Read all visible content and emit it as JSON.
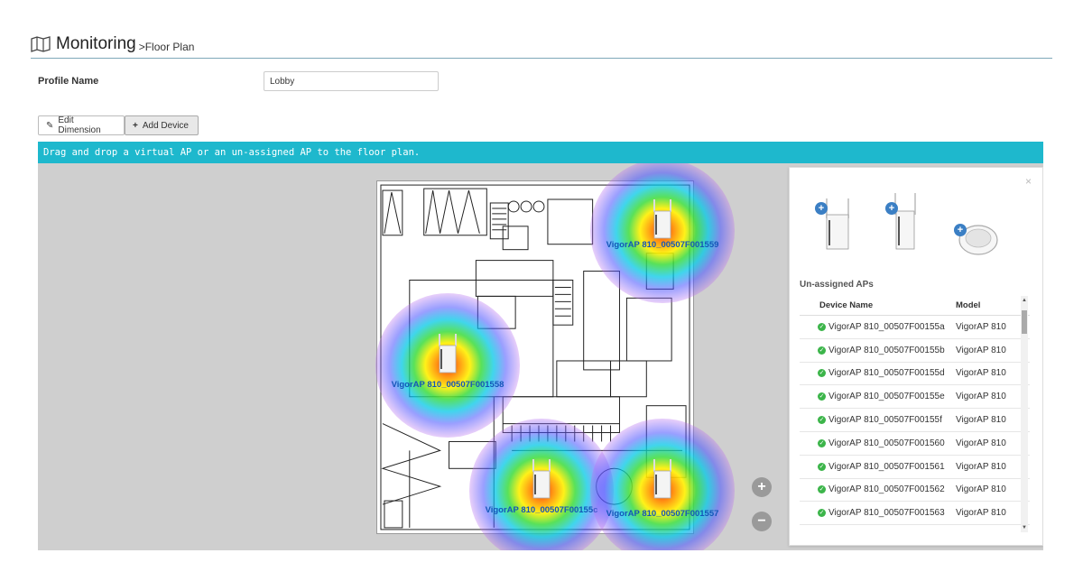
{
  "header": {
    "title": "Monitoring",
    "breadcrumb": ">Floor Plan",
    "icon": "map-icon"
  },
  "profile": {
    "label": "Profile Name",
    "value": "Lobby"
  },
  "toolbar": {
    "edit_label": "Edit Dimension",
    "add_label": "Add Device"
  },
  "banner": {
    "text": "Drag and drop a virtual AP or an un-assigned AP to the floor plan.",
    "color": "#1eb8cd"
  },
  "placed_aps": [
    {
      "name": "VigorAP 810_00507F001559"
    },
    {
      "name": "VigorAP 810_00507F001558"
    },
    {
      "name": "VigorAP 810_00507F00155c"
    },
    {
      "name": "VigorAP 810_00507F001557"
    }
  ],
  "zoom": {
    "in": "+",
    "out": "−"
  },
  "panel": {
    "close": "×",
    "subtitle": "Un-assigned APs",
    "columns": {
      "device": "Device Name",
      "model": "Model"
    },
    "rows": [
      {
        "device": "VigorAP 810_00507F00155a",
        "model": "VigorAP 810"
      },
      {
        "device": "VigorAP 810_00507F00155b",
        "model": "VigorAP 810"
      },
      {
        "device": "VigorAP 810_00507F00155d",
        "model": "VigorAP 810"
      },
      {
        "device": "VigorAP 810_00507F00155e",
        "model": "VigorAP 810"
      },
      {
        "device": "VigorAP 810_00507F00155f",
        "model": "VigorAP 810"
      },
      {
        "device": "VigorAP 810_00507F001560",
        "model": "VigorAP 810"
      },
      {
        "device": "VigorAP 810_00507F001561",
        "model": "VigorAP 810"
      },
      {
        "device": "VigorAP 810_00507F001562",
        "model": "VigorAP 810"
      },
      {
        "device": "VigorAP 810_00507F001563",
        "model": "VigorAP 810"
      }
    ]
  }
}
